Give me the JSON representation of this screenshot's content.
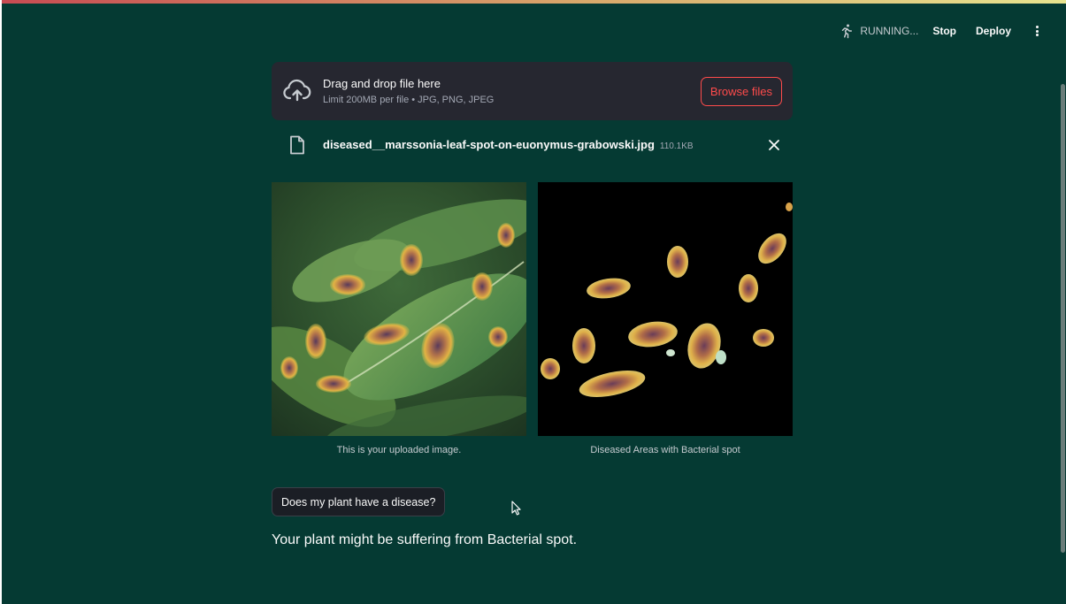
{
  "header": {
    "status": "RUNNING...",
    "stop_label": "Stop",
    "deploy_label": "Deploy",
    "running_icon": "running-figure-icon",
    "menu_icon": "kebab-menu-icon"
  },
  "uploader": {
    "title": "Drag and drop file here",
    "limit": "Limit 200MB per file • JPG, PNG, JPEG",
    "browse_label": "Browse files",
    "icon": "cloud-upload-icon"
  },
  "file": {
    "name": "diseased__marssonia-leaf-spot-on-euonymus-grabowski.jpg",
    "size": "110.1KB",
    "icon": "file-icon",
    "remove_icon": "close-icon"
  },
  "images": {
    "uploaded_caption": "This is your uploaded image.",
    "diseased_caption": "Diseased Areas with Bacterial spot"
  },
  "action": {
    "button_label": "Does my plant have a disease?"
  },
  "result": {
    "text": "Your plant might be suffering from Bacterial spot."
  },
  "colors": {
    "background": "#053a33",
    "card": "#262730",
    "accent": "#ff4b4b",
    "text": "#fafafa"
  }
}
